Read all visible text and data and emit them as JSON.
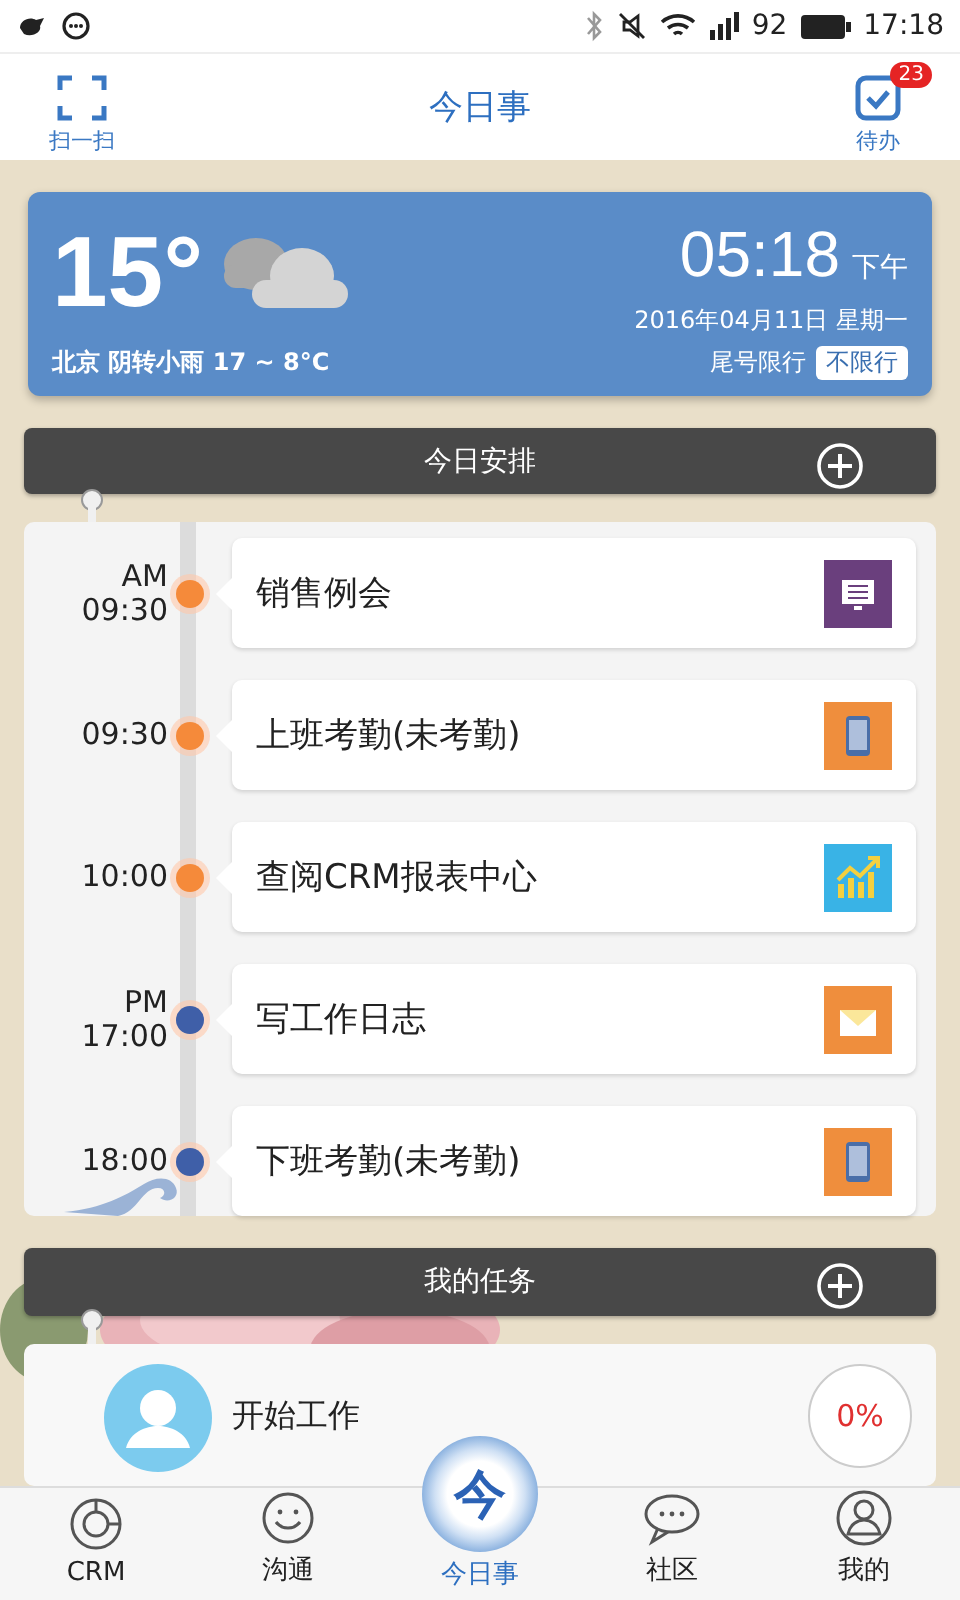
{
  "status_bar": {
    "battery": "92",
    "time": "17:18"
  },
  "header": {
    "title": "今日事",
    "scan_label": "扫一扫",
    "todo_label": "待办",
    "todo_badge": "23"
  },
  "weather": {
    "temperature": "15°",
    "summary": "北京 阴转小雨 17 ~ 8°C",
    "clock": "05:18",
    "meridiem": "下午",
    "date": "2016年04月11日 星期一",
    "restriction_label": "尾号限行",
    "restriction_value": "不限行"
  },
  "schedule": {
    "title": "今日安排",
    "items": [
      {
        "period": "AM",
        "time": "09:30",
        "title": "销售例会",
        "color": "#f58a3a",
        "kind": "meeting"
      },
      {
        "time": "09:30",
        "title": "上班考勤(未考勤)",
        "color": "#f58a3a",
        "kind": "phone"
      },
      {
        "time": "10:00",
        "title": "查阅CRM报表中心",
        "color": "#f58a3a",
        "kind": "chart"
      },
      {
        "period": "PM",
        "time": "17:00",
        "title": "写工作日志",
        "color": "#3f5fa8",
        "kind": "mail"
      },
      {
        "time": "18:00",
        "title": "下班考勤(未考勤)",
        "color": "#3f5fa8",
        "kind": "phone"
      }
    ]
  },
  "tasks": {
    "title": "我的任务",
    "items": [
      {
        "title": "开始工作",
        "progress": "0%"
      }
    ]
  },
  "nav": [
    {
      "label": "CRM",
      "kind": "crm",
      "selected": false
    },
    {
      "label": "沟通",
      "kind": "chat",
      "selected": false
    },
    {
      "label": "今日事",
      "kind": "today",
      "logo": "今",
      "selected": true
    },
    {
      "label": "社区",
      "kind": "community",
      "selected": false
    },
    {
      "label": "我的",
      "kind": "me",
      "selected": false
    }
  ]
}
